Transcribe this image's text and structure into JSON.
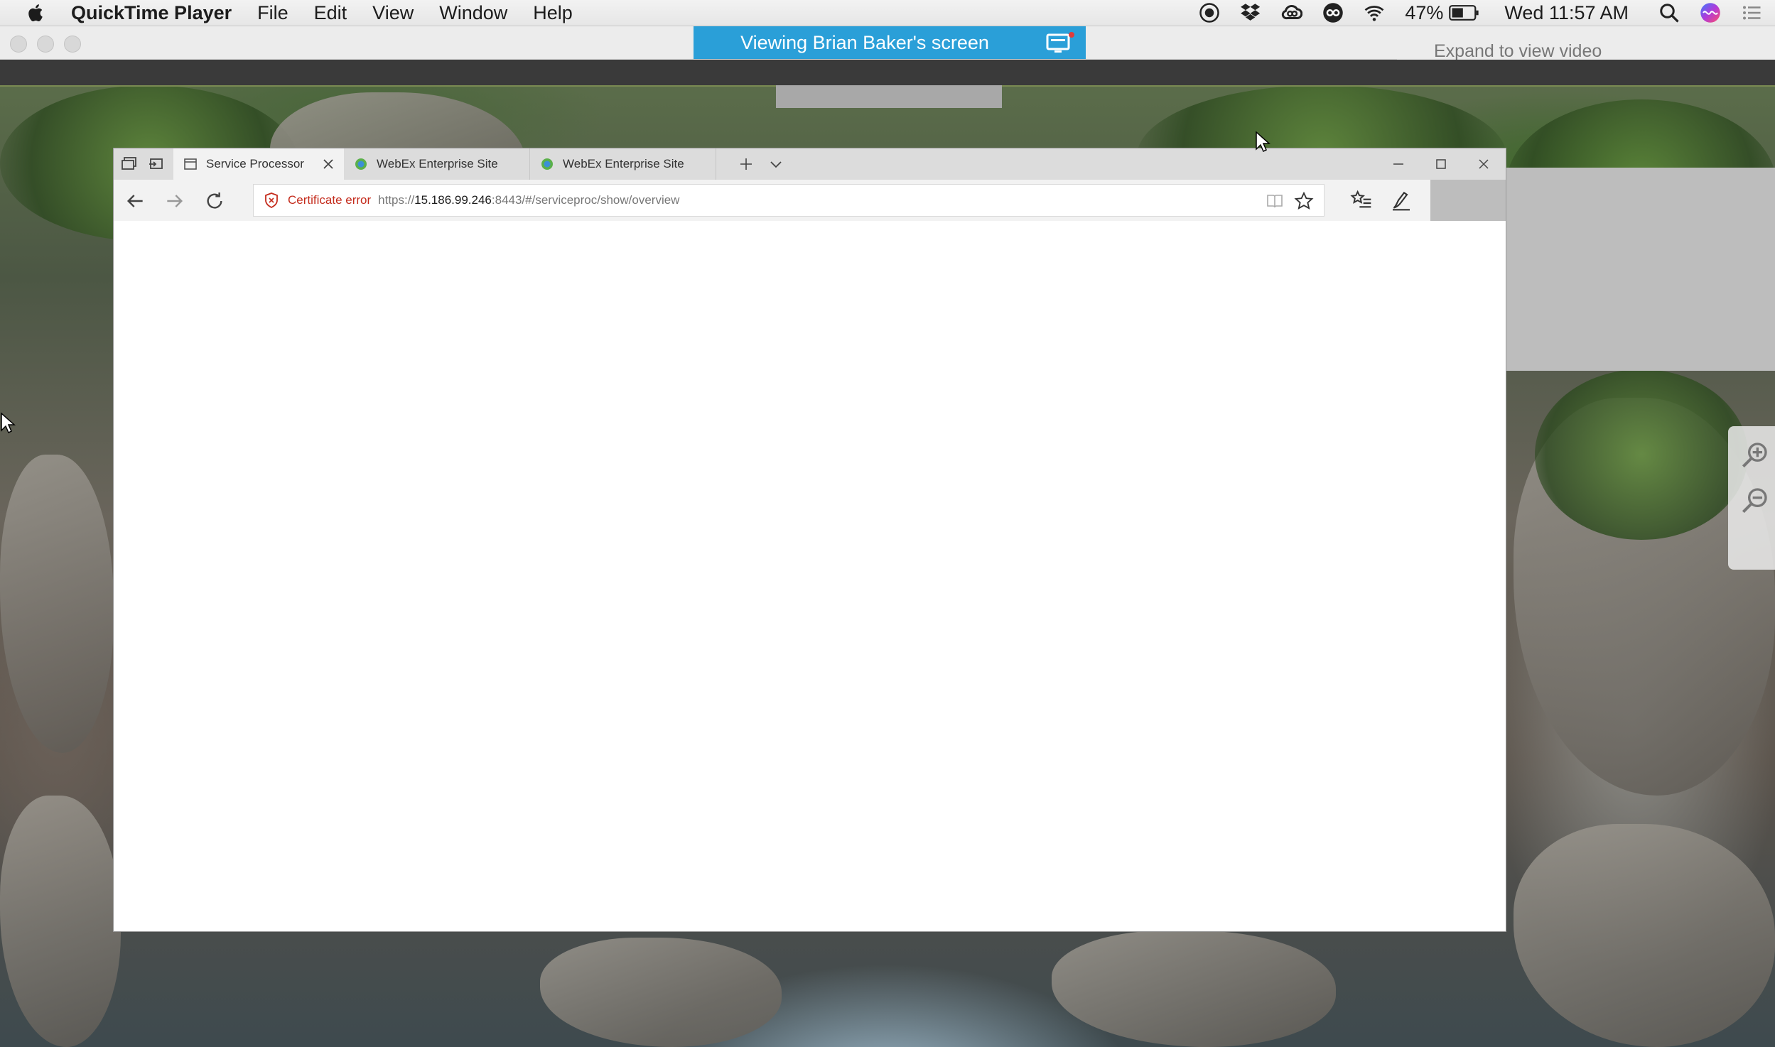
{
  "menubar": {
    "app_name": "QuickTime Player",
    "menus": [
      "File",
      "Edit",
      "View",
      "Window",
      "Help"
    ],
    "battery_percent": "47%",
    "clock": "Wed 11:57 AM",
    "status_icons": [
      "record-icon",
      "dropbox-icon",
      "creative-cloud-icon",
      "owncloud-icon",
      "wifi-icon",
      "battery-icon",
      "spotlight-icon",
      "siri-icon",
      "notification-center-icon"
    ]
  },
  "quicktime": {
    "viewing_banner": "Viewing Brian Baker's screen",
    "expand_video": "Expand to view video"
  },
  "browser": {
    "tabs": [
      {
        "label": "Service Processor",
        "active": true
      },
      {
        "label": "WebEx Enterprise Site",
        "active": false
      },
      {
        "label": "WebEx Enterprise Site",
        "active": false
      }
    ],
    "address": {
      "cert_error": "Certificate error",
      "url_prefix": "https://",
      "url_host": "15.186.99.246",
      "url_path": ":8443/#/serviceproc/show/overview"
    }
  },
  "colors": {
    "banner": "#2a9fd8",
    "cert_error": "#c42b1c",
    "browser_chrome": "#f2f2f2"
  }
}
